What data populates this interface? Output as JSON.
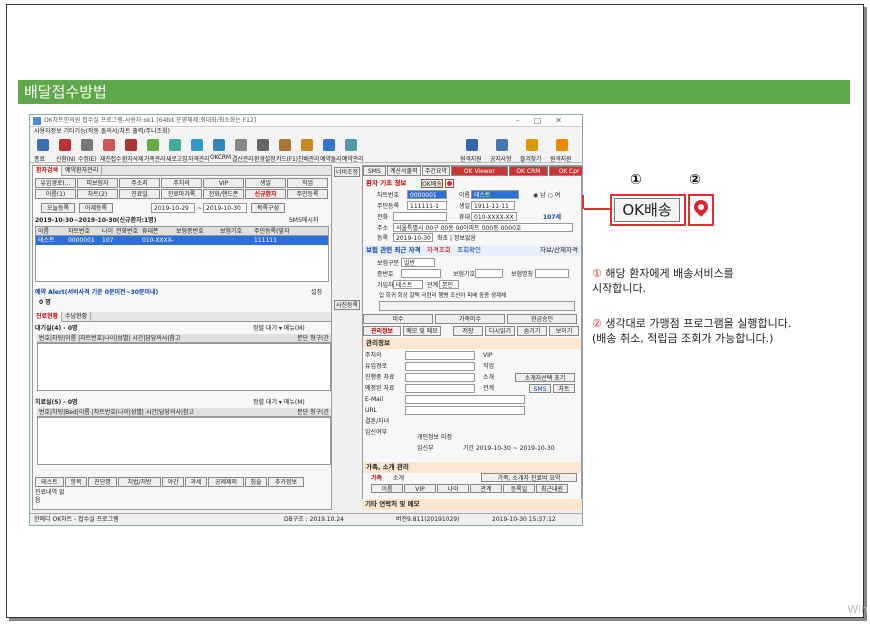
{
  "slide_title": "배달접수방법",
  "app": {
    "window_title": "OK차트한의원 접수실 프로그램-사용자:ok1 [64bit 운영체제:최대화/최소화는 F12]",
    "menu": "사용자정보  기타기능(작동 돌의서/차트 출력/주니조회)",
    "toolbar": [
      {
        "label": "종료",
        "icon": "exit-icon",
        "color": "#3a6fb5"
      },
      {
        "label": "신환(N)",
        "icon": "new-patient-icon",
        "color": "#b33"
      },
      {
        "label": "수정(E)",
        "icon": "edit-icon",
        "color": "#777"
      },
      {
        "label": "재진접수",
        "icon": "revisit-icon",
        "color": "#c55"
      },
      {
        "label": "환자삭제",
        "icon": "delete-icon",
        "color": "#a33"
      },
      {
        "label": "가족관리",
        "icon": "family-icon",
        "color": "#6a4"
      },
      {
        "label": "새로고침",
        "icon": "refresh-icon",
        "color": "#4a9"
      },
      {
        "label": "자격관리",
        "icon": "qualification-icon",
        "color": "#39c"
      },
      {
        "label": "OKCRM",
        "icon": "crm-icon",
        "color": "#38b"
      },
      {
        "label": "결산관리",
        "icon": "settlement-icon",
        "color": "#888"
      },
      {
        "label": "환경설정",
        "icon": "settings-icon",
        "color": "#666"
      },
      {
        "label": "카드(F1)",
        "icon": "card-icon",
        "color": "#a73"
      },
      {
        "label": "찬배관리",
        "icon": "delivery-icon",
        "color": "#c82"
      },
      {
        "label": "예약돌리",
        "icon": "reservation-icon",
        "color": "#37c"
      },
      {
        "label": "예약관리",
        "icon": "calendar-icon",
        "color": "#59a"
      }
    ],
    "toolbar_right": [
      {
        "label": "원격지원",
        "icon": "remote-icon",
        "color": "#36a"
      },
      {
        "label": "공지사항",
        "icon": "notice-icon",
        "color": "#47a"
      },
      {
        "label": "즐겨찾기",
        "icon": "favorite-icon",
        "color": "#d90"
      },
      {
        "label": "원격지원",
        "icon": "remote-support-icon",
        "color": "#e80"
      }
    ],
    "left": {
      "tabs": [
        "환자검색",
        "예약환자관리"
      ],
      "filters_row1": [
        "유입경로(...",
        "피보험자",
        "주소지",
        "주치의",
        "VIP",
        "생일",
        "직업"
      ],
      "filters_row2": [
        "이름(1)",
        "차트(2)",
        "진료일",
        "진료마가록",
        "전화/핸드폰",
        "신규환자",
        "주민등록"
      ],
      "today_btn": "오늘등록",
      "yesterday_btn": "어제등록",
      "date_from": "2019-10-29",
      "date_to": "2019-10-30",
      "list_btn": "목록구성",
      "range_title": "2019-10-30~2019-10-30(신규환자:1명)",
      "sms_label": "SMS메시지",
      "table_headers": [
        "이름",
        "차트번호",
        "나이",
        "전화번호",
        "휴대폰",
        "보험증번호",
        "보험기호",
        "주민등록(앞자"
      ],
      "table_row": [
        "테스트",
        "0000001",
        "107",
        "",
        "010-XXXX-",
        "",
        "",
        "111111"
      ],
      "reservation_alert": "예약 Alert(서비사격 기준 0분미전~30분미내)",
      "reservation_count": "0 명",
      "settings_label": "설정",
      "waiting_tabs": [
        "진료현황",
        "수납현황"
      ],
      "waiting_title": "대기실(4) - 0명",
      "waiting_headers": "번호|차팅|이름 |차트번호|나이|성별| 시간|담당의사|참고",
      "waiting_right": "정렬 대기 ▾ 메뉴(M)",
      "waiting_right2": "분단 청구(간",
      "treatment_title": "치료실(5) - 0명",
      "treatment_headers": "번호|차팅|Bed|이름 |차트번호|나이|성별| 시간|담당의사|참고",
      "bottom_tabs": [
        "테스트",
        "항목",
        "진단명",
        "치법/처방",
        "야간",
        "과세",
        "공제제외",
        "침술",
        "추가정보"
      ],
      "bottom_label": "진료내역 없음",
      "side_tab1": "너비조정",
      "side_tab2": "사진등록"
    },
    "right": {
      "top_tabs": [
        "SMS",
        "계산서출력",
        "주간요약",
        "OK Viewer",
        "OK CRM",
        "OK Cpr",
        "OK 방문"
      ],
      "basic_info": "환자 기초 정보",
      "ok_delivery_small": "OK배송",
      "chart_no_label": "차트번호",
      "chart_no": "0000001",
      "name_label": "이름",
      "name": "테스트",
      "gender_m": "남",
      "gender_f": "여",
      "ssn_label": "주민등록",
      "ssn": "111111-1",
      "birth_label": "생일",
      "birth": "1911-11-11",
      "phone_label": "전화",
      "mobile_label": "휴대",
      "mobile": "010-XXXX-XX",
      "age": "107세",
      "addr_label": "주소",
      "addr": "서울특별시 00구 00동 00아파트 000동 0000호",
      "reg_label": "등록",
      "reg_date": "2019-10-30",
      "reg_extra": "최초 | 정보없음",
      "insurance_title": "보험 관련 최근 자격",
      "insurance_tabs": [
        "자격조회",
        "조회확인"
      ],
      "insurance_right": "자보/산재자격",
      "ins_type_label": "보험구분",
      "ins_type": "일반",
      "cert_label": "증번호",
      "sym_label": "보험기호",
      "ins_name_label": "보험명칭",
      "holder_label": "가입자",
      "holder": "테스트",
      "rel_label": "관계",
      "rel": "본인",
      "stats_labels": "입 회귀  회상 갈택 극련리 행병 조산아 피배 중증 생계체",
      "payment_tabs": [
        "미수",
        "가족미수",
        "현금승인"
      ],
      "memo_tabs": [
        "관리정보",
        "메모 및 메모"
      ],
      "memo_btns": [
        "저장",
        "다시읽기",
        "숨기기",
        "보이기"
      ],
      "mgmt_title": "관리정보",
      "mgmt_fields": [
        "주치의",
        "유입경로",
        "진행중 차료",
        "예정된 차료",
        "E-Mail",
        "URL",
        "결혼/자녀",
        "임신여부"
      ],
      "mgmt_right": [
        "VIP",
        "직업",
        "소개",
        "관계",
        "소개자선택",
        "초기"
      ],
      "mgmt_misc": [
        "SMS",
        "차트"
      ],
      "marry_text": "개인정보 미정",
      "preg_text": "임신부",
      "period_text": "기간 2019-10-30 ~ 2019-10-30",
      "family_title": "가족, 소개 관리",
      "family_tabs": [
        "가족",
        "소개"
      ],
      "family_right": "가족, 소개자 진료비 요약",
      "family_headers": [
        "이름",
        "VIP",
        "나이",
        "관계",
        "등록일",
        "최근내원"
      ],
      "family_btns": [
        "정보보기",
        "차트보기",
        "대기실접수",
        "치료실접수",
        "가족관리"
      ],
      "other_title": "기타 연락처 및 메모"
    },
    "status": {
      "left": "한예디 OK차트 - 접수실 프로그램",
      "db": "DB구조 : 2019.10.24",
      "version": "버전9.811(20191029)",
      "time": "2019-10-30 15:37:12"
    }
  },
  "callout": {
    "num1": "①",
    "num2": "②",
    "ok_button": "OK배송",
    "desc1_num": "①",
    "desc1": "해당 환자에게 배송서비스를\n시작합니다.",
    "desc2_num": "②",
    "desc2": "생각대로 가맹점 프로그램을 실행합니다.\n(배송 취소, 적립금 조회가 가능합니다.)"
  },
  "watermark": "Win"
}
